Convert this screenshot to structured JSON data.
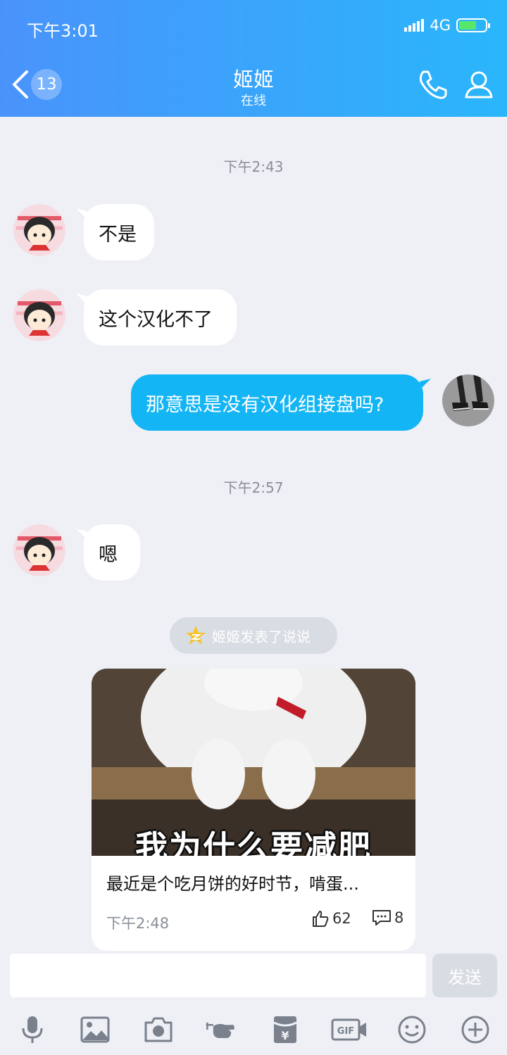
{
  "status_bar": {
    "time": "下午3:01",
    "network": "4G"
  },
  "header": {
    "back_icon": "chevron-left-icon",
    "unread_count": "13",
    "title": "姬姬",
    "subtitle": "在线",
    "phone_icon": "phone-icon",
    "profile_icon": "user-icon"
  },
  "chat": {
    "timestamps": [
      "下午2:43",
      "下午2:57"
    ],
    "messages": [
      {
        "from": "contact",
        "text": "不是"
      },
      {
        "from": "contact",
        "text": "这个汉化不了"
      },
      {
        "from": "me",
        "text": "那意思是没有汉化组接盘吗?"
      },
      {
        "from": "contact",
        "text": "嗯"
      }
    ]
  },
  "feed": {
    "notice": "姬姬发表了说说",
    "image_caption": "我为什么要减肥",
    "text": "最近是个吃月饼的好时节，啃蛋...",
    "time": "下午2:48",
    "likes": "62",
    "comments": "8"
  },
  "input": {
    "placeholder": "",
    "send_label": "发送"
  },
  "toolbar": [
    "microphone-icon",
    "image-icon",
    "camera-icon",
    "poke-icon",
    "red-packet-icon",
    "gif-icon",
    "emoji-icon",
    "plus-icon"
  ],
  "colors": {
    "header_start": "#4a93fb",
    "header_end": "#2ab6fb",
    "out_bubble": "#13b5f4",
    "background": "#eef0f6"
  }
}
